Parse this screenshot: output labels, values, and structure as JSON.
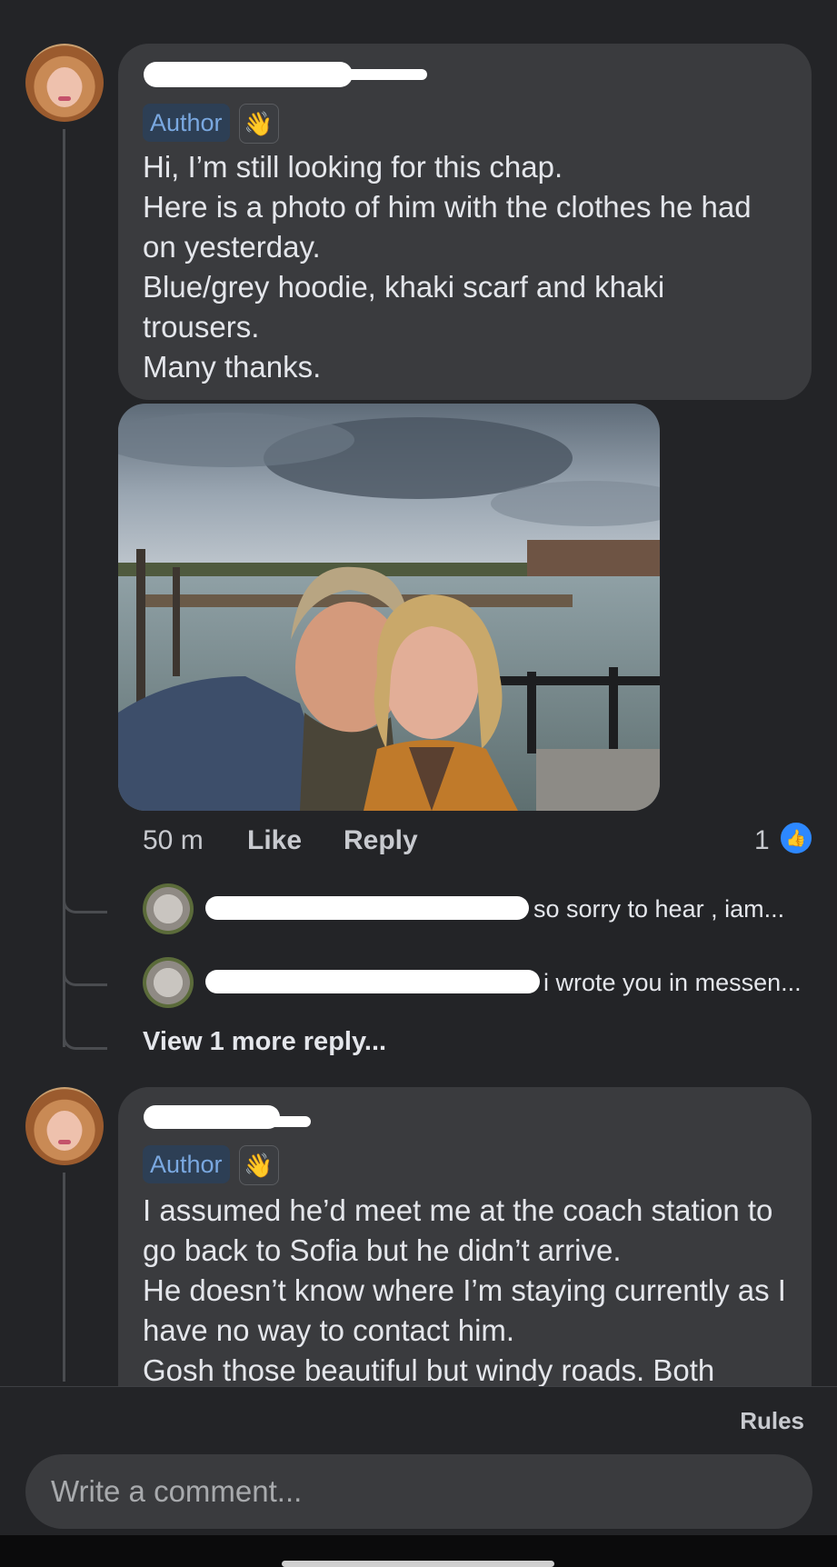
{
  "comments": [
    {
      "author_badge": "Author",
      "text": "Hi, I’m still looking for this chap.\nHere is a photo of him with the clothes he had on yesterday.\nBlue/grey hoodie, khaki scarf and khaki trousers.\nMany thanks.",
      "time": "50 m",
      "like_label": "Like",
      "reply_label": "Reply",
      "reaction_count": "1",
      "replies": [
        {
          "text": "so sorry to hear , iam..."
        },
        {
          "text": "i wrote you in messen..."
        }
      ],
      "view_more": "View 1 more reply..."
    },
    {
      "author_badge": "Author",
      "text": "I assumed he’d meet me at the coach station to go back to Sofia but he didn’t arrive.\nHe doesn’t know where I’m staying currently as I have no way to contact him.\nGosh those beautiful but windy roads. Both"
    }
  ],
  "footer": {
    "rules_label": "Rules",
    "comment_placeholder": "Write a comment..."
  },
  "icons": {
    "wave": "waving-hand-icon",
    "like_reaction": "thumbs-up-icon"
  },
  "colors": {
    "background": "#232427",
    "bubble": "#3a3b3e",
    "author_badge_text": "#7aa8e0",
    "like_blue": "#2d88ff"
  }
}
